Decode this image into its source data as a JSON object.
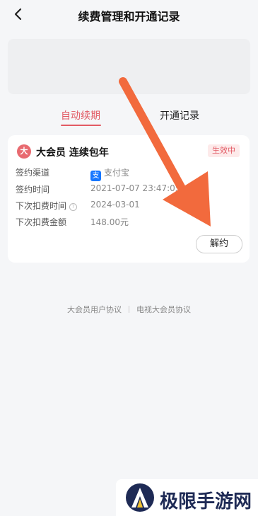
{
  "header": {
    "title": "续费管理和开通记录",
    "back_icon": "chevron-left-icon"
  },
  "tabs": [
    {
      "label": "自动续期",
      "active": true
    },
    {
      "label": "开通记录",
      "active": false
    }
  ],
  "subscription": {
    "icon_text": "大",
    "title": "大会员 连续包年",
    "status": "生效中",
    "rows": [
      {
        "label": "签约渠道",
        "value": "支付宝",
        "icon": "alipay-icon",
        "icon_text": "支"
      },
      {
        "label": "签约时间",
        "value": "2021-07-07 23:47:05"
      },
      {
        "label": "下次扣费时间",
        "value": "2024-03-01",
        "help_icon": "?"
      },
      {
        "label": "下次扣费金额",
        "value": "148.00元"
      }
    ],
    "cancel_label": "解约"
  },
  "footer_links": [
    "大会员用户协议",
    "电视大会员协议"
  ],
  "watermark": {
    "text": "极限手游网"
  },
  "colors": {
    "accent": "#e25a64",
    "arrow": "#f26a3d",
    "alipay": "#1677ff"
  }
}
